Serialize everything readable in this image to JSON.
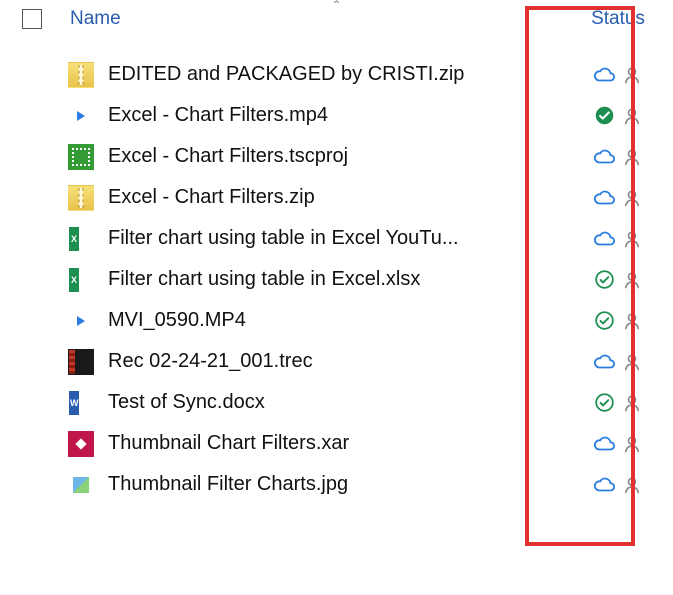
{
  "header": {
    "name_label": "Name",
    "status_label": "Status",
    "sort_indicator": "⌃"
  },
  "files": [
    {
      "name": "EDITED and PACKAGED by CRISTI.zip",
      "icon": "zip",
      "status": "cloud",
      "shared": true
    },
    {
      "name": "Excel - Chart Filters.mp4",
      "icon": "mp4",
      "status": "sync-solid",
      "shared": true
    },
    {
      "name": "Excel - Chart Filters.tscproj",
      "icon": "tscproj",
      "status": "cloud",
      "shared": true
    },
    {
      "name": "Excel - Chart Filters.zip",
      "icon": "zip",
      "status": "cloud",
      "shared": true
    },
    {
      "name": "Filter chart using table in Excel YouTu...",
      "icon": "xlsx",
      "status": "cloud",
      "shared": true
    },
    {
      "name": "Filter chart using table in Excel.xlsx",
      "icon": "xlsx",
      "status": "sync-outline",
      "shared": true
    },
    {
      "name": "MVI_0590.MP4",
      "icon": "mp4",
      "status": "sync-outline",
      "shared": true
    },
    {
      "name": "Rec 02-24-21_001.trec",
      "icon": "trec",
      "status": "cloud",
      "shared": true
    },
    {
      "name": "Test of Sync.docx",
      "icon": "docx",
      "status": "sync-outline",
      "shared": true
    },
    {
      "name": "Thumbnail Chart Filters.xar",
      "icon": "xar",
      "status": "cloud",
      "shared": true
    },
    {
      "name": "Thumbnail Filter Charts.jpg",
      "icon": "jpg",
      "status": "cloud",
      "shared": true
    }
  ],
  "colors": {
    "cloud": "#2a7de1",
    "sync_green": "#1d8f50",
    "person": "#8a8a8a",
    "highlight": "#e03030"
  }
}
